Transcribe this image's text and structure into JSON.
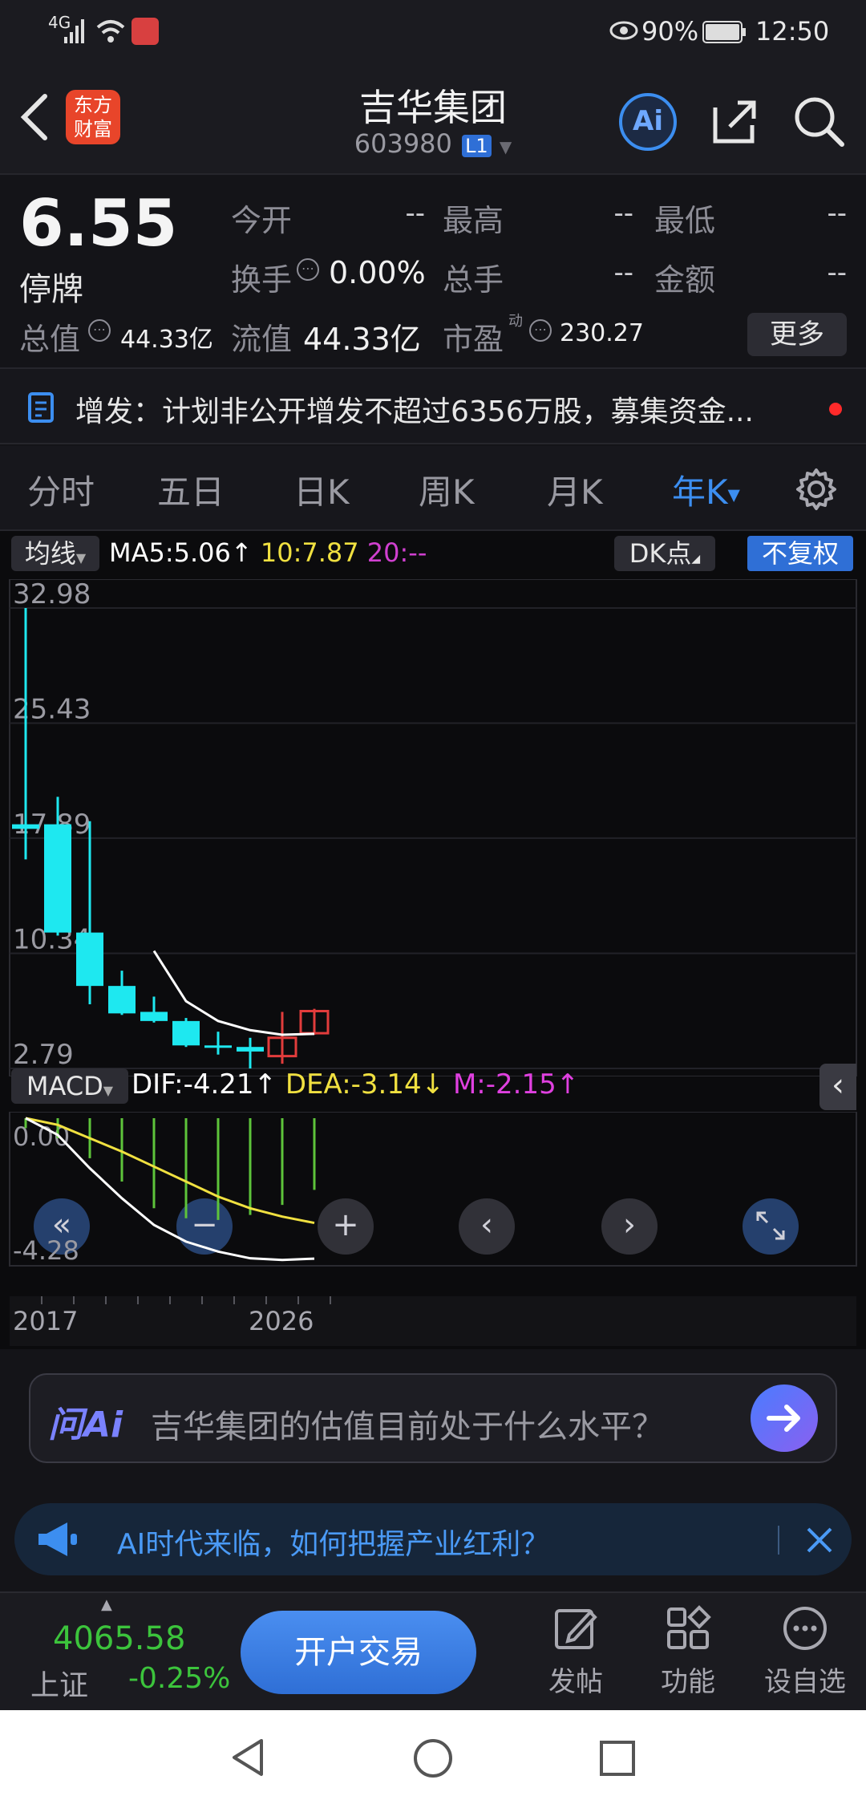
{
  "status_bar": {
    "network": "4G",
    "battery": "90%",
    "time": "12:50"
  },
  "header": {
    "app_logo_line1": "东方",
    "app_logo_line2": "财富",
    "title": "吉华集团",
    "code": "603980",
    "level": "L1",
    "ai_label": "Ai"
  },
  "quote": {
    "price": "6.55",
    "status": "停牌",
    "fields": [
      {
        "label": "今开",
        "value": "--"
      },
      {
        "label": "最高",
        "value": "--"
      },
      {
        "label": "最低",
        "value": "--"
      },
      {
        "label": "换手",
        "value": "0.00%"
      },
      {
        "label": "总手",
        "value": "--"
      },
      {
        "label": "金额",
        "value": "--"
      }
    ],
    "total_cap_label": "总值",
    "total_cap_value": "44.33亿",
    "float_cap_label": "流值",
    "float_cap_value": "44.33亿",
    "pe_label": "市盈",
    "pe_superscript": "动",
    "pe_value": "230.27",
    "more_button": "更多"
  },
  "notice": {
    "text": "增发：计划非公开增发不超过6356万股，募集资金..."
  },
  "tabs": [
    "分时",
    "五日",
    "日K",
    "周K",
    "月K",
    "年K"
  ],
  "active_tab_index": 5,
  "chart_toolbar": {
    "indicator_select": "均线",
    "ma5": "MA5:5.06",
    "ma10": "10:7.87",
    "ma20": "20:--",
    "dk_button": "DK点",
    "adjust_button": "不复权"
  },
  "macd_toolbar": {
    "indicator_select": "MACD",
    "dif": "DIF:-4.21",
    "dea": "DEA:-3.14",
    "m": "M:-2.15"
  },
  "colors": {
    "up": "#e23c3c",
    "down": "#1ee8f0",
    "ma5": "#ffffff",
    "ma10": "#f0e040",
    "ma20": "#d040d0",
    "macd_bar": "#5ec43a",
    "accent_blue": "#3c8ef0",
    "index_green": "#3cc43c"
  },
  "chart_data": [
    {
      "type": "candlestick",
      "title": "",
      "y_tick_labels": [
        "32.98",
        "25.43",
        "17.89",
        "10.34",
        "2.79"
      ],
      "ylim": [
        2.79,
        32.98
      ],
      "candles": [
        {
          "open": 18.8,
          "close": 18.5,
          "high": 32.98,
          "low": 16.5
        },
        {
          "open": 18.8,
          "close": 11.7,
          "high": 20.6,
          "low": 11.5
        },
        {
          "open": 11.7,
          "close": 8.2,
          "high": 19.0,
          "low": 7.0
        },
        {
          "open": 8.2,
          "close": 6.4,
          "high": 9.2,
          "low": 6.3
        },
        {
          "open": 6.5,
          "close": 5.9,
          "high": 7.5,
          "low": 5.8
        },
        {
          "open": 5.9,
          "close": 4.3,
          "high": 6.1,
          "low": 4.2
        },
        {
          "open": 4.3,
          "close": 4.2,
          "high": 5.2,
          "low": 3.7
        },
        {
          "open": 4.2,
          "close": 3.9,
          "high": 4.8,
          "low": 2.79
        },
        {
          "open": 3.6,
          "close": 4.8,
          "high": 6.5,
          "low": 3.1
        },
        {
          "open": 5.1,
          "close": 6.55,
          "high": 6.7,
          "low": 5.0
        }
      ],
      "ma5": [
        null,
        null,
        null,
        null,
        10.5,
        7.2,
        5.9,
        5.3,
        5.0,
        5.06
      ]
    },
    {
      "type": "bar",
      "title": "",
      "x_tick_labels": [
        "2017",
        "2026"
      ],
      "y_tick_labels": [
        "0.00",
        "-4.28"
      ],
      "ylim": [
        -4.28,
        0.0
      ],
      "m": [
        -0.3,
        -0.6,
        -1.2,
        -1.9,
        -2.7,
        -3.0,
        -3.05,
        -2.9,
        -2.6,
        -2.15
      ],
      "dif": [
        0.0,
        -0.5,
        -1.5,
        -2.4,
        -3.2,
        -3.7,
        -4.0,
        -4.2,
        -4.25,
        -4.21
      ],
      "dea": [
        0.0,
        -0.2,
        -0.6,
        -1.0,
        -1.45,
        -1.9,
        -2.35,
        -2.7,
        -2.95,
        -3.14
      ]
    }
  ],
  "chart_controls": [
    "«",
    "+",
    "‹",
    "›"
  ],
  "ai_prompt": {
    "brand": "问Ai",
    "question": "吉华集团的估值目前处于什么水平？"
  },
  "ad_banner": {
    "text": "AI时代来临，如何把握产业红利？"
  },
  "bottom_bar": {
    "index_value": "4065.58",
    "index_name": "上证",
    "index_change": "-0.25%",
    "open_account": "开户交易",
    "post": "发帖",
    "functions": "功能",
    "watchlist": "设自选"
  }
}
